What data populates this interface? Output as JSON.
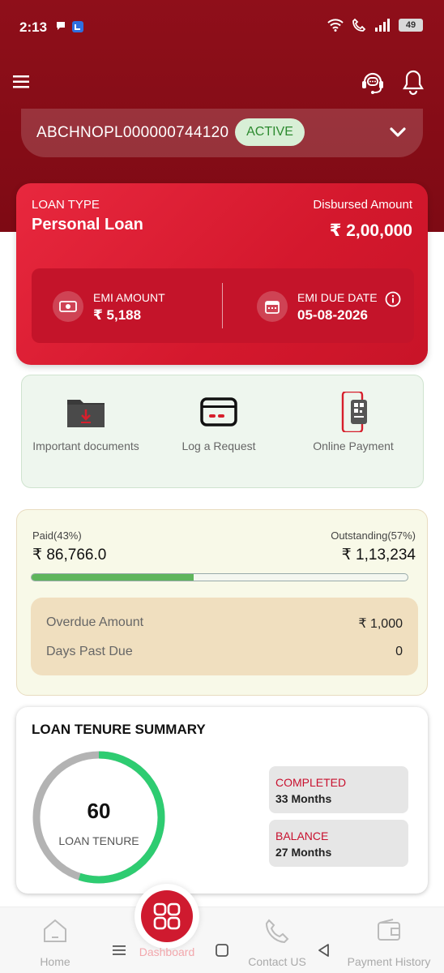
{
  "status_bar": {
    "time": "2:13",
    "battery": "49"
  },
  "account": {
    "number": "ABCHNOPL000000744120",
    "status": "ACTIVE"
  },
  "loan_card": {
    "loan_type_label": "LOAN TYPE",
    "loan_type_value": "Personal Loan",
    "disbursed_label": "Disbursed Amount",
    "disbursed_value": "₹ 2,00,000",
    "emi_amount_label": "EMI AMOUNT",
    "emi_amount_value": "₹ 5,188",
    "emi_due_label": "EMI DUE DATE",
    "emi_due_value": "05-08-2026"
  },
  "actions": [
    {
      "label": "Important documents",
      "icon": "folder-download-icon"
    },
    {
      "label": "Log a Request",
      "icon": "card-request-icon"
    },
    {
      "label": "Online Payment",
      "icon": "phone-qr-icon"
    }
  ],
  "payment": {
    "paid_label": "Paid(43%)",
    "paid_value": "₹ 86,766.0",
    "outstanding_label": "Outstanding(57%)",
    "outstanding_value": "₹ 1,13,234",
    "paid_fraction": 0.43,
    "overdue_label": "Overdue Amount",
    "overdue_value": "₹ 1,000",
    "dpd_label": "Days Past Due",
    "dpd_value": "0"
  },
  "tenure": {
    "title": "LOAN TENURE SUMMARY",
    "total": "60",
    "total_label": "LOAN TENURE",
    "completed_label": "COMPLETED",
    "completed_value": "33 Months",
    "balance_label": "BALANCE",
    "balance_value": "27 Months",
    "completed_months": 33,
    "total_months": 60
  },
  "nav": {
    "home": "Home",
    "dashboard": "Dashboard",
    "contact": "Contact US",
    "payment_history": "Payment History"
  },
  "colors": {
    "brand_dark": "#8f0f1a",
    "brand_red": "#d4182d",
    "success_green": "#2ecc71",
    "progress_green": "#5fb55c"
  }
}
